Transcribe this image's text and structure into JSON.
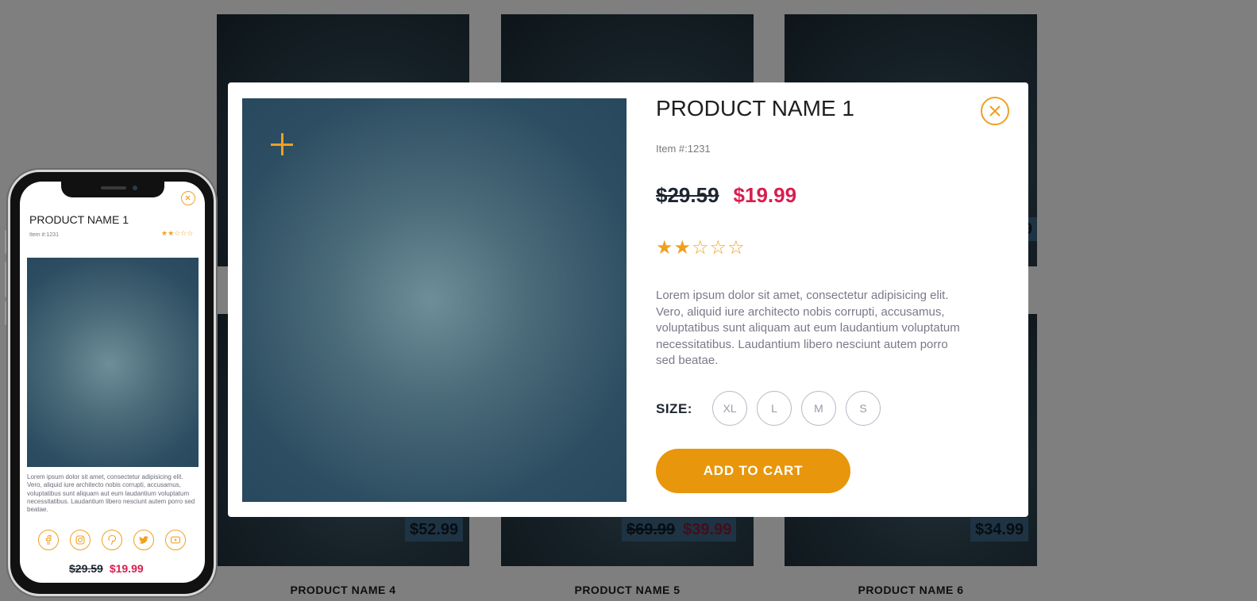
{
  "grid": {
    "cards": [
      {
        "price": "",
        "name": ""
      },
      {
        "price": "",
        "name": ""
      },
      {
        "price": "",
        "name": ""
      },
      {
        "price": "$52.99",
        "name": "PRODUCT NAME 4"
      },
      {
        "old_price": "$69.99",
        "price": "$39.99",
        "name": "PRODUCT NAME 5"
      },
      {
        "price": "$34.99",
        "name": "PRODUCT NAME 6"
      }
    ],
    "partial_price_glyph": "9"
  },
  "modal": {
    "title": "PRODUCT NAME 1",
    "item_number": "Item #:1231",
    "old_price": "$29.59",
    "new_price": "$19.99",
    "rating": 2,
    "rating_max": 5,
    "description": "Lorem ipsum dolor sit amet, consectetur adipisicing elit. Vero, aliquid iure architecto nobis corrupti, accusamus, voluptatibus sunt aliquam aut eum laudantium voluptatum necessitatibus. Laudantium libero nesciunt autem porro sed beatae.",
    "size_label": "SIZE:",
    "sizes": [
      "XL",
      "L",
      "M",
      "S"
    ],
    "add_to_cart": "ADD TO CART",
    "accent_color": "#e8960c",
    "sale_color": "#d81e4f"
  },
  "phone": {
    "title": "PRODUCT NAME 1",
    "item_number": "Item #:1231",
    "rating": 2,
    "description": "Lorem ipsum dolor sit amet, consectetur adipisicing elit. Vero, aliquid iure architecto nobis corrupti, accusamus, voluptatibus sunt aliquam aut eum laudantium voluptatum necessitatibus. Laudantium libero nesciunt autem porro sed beatae.",
    "social_icons": [
      "facebook-icon",
      "instagram-icon",
      "pinterest-icon",
      "twitter-icon",
      "youtube-icon"
    ],
    "old_price": "$29.59",
    "new_price": "$19.99"
  }
}
